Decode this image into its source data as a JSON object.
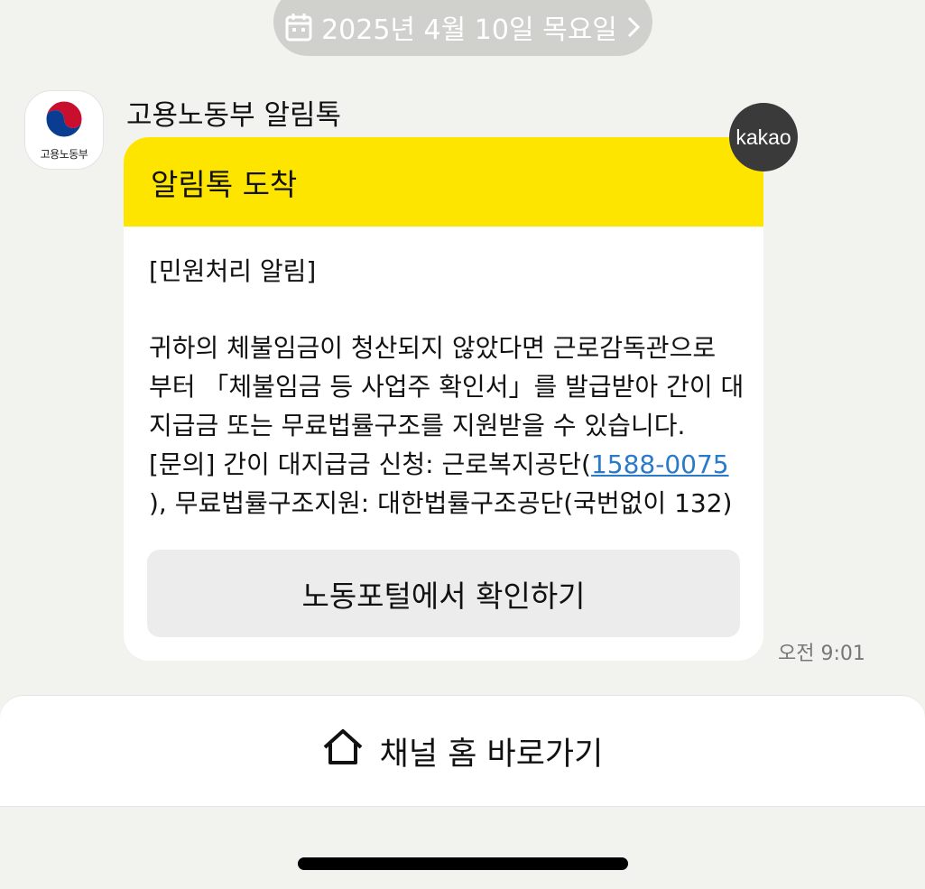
{
  "date_separator": {
    "icon": "calendar-icon",
    "text": "2025년 4월 10일 목요일",
    "chevron": "chevron-right-icon"
  },
  "sender": {
    "avatar_text": "고용노동부",
    "name": "고용노동부 알림톡"
  },
  "message": {
    "header": "알림톡 도착",
    "lines": [
      "[민원처리 알림]",
      "귀하의 체불임금이 청산되지 않았다면 근로감독관으로",
      "부터 「체불임금 등 사업주 확인서」를 발급받아 간이 대",
      "지급금 또는 무료법률구조를 지원받을 수 있습니다."
    ],
    "inquiry_prefix": "[문의] 간이 대지급금 신청: 근로복지공단(",
    "inquiry_phone": "1588-0075",
    "inquiry_suffix": "), 무료법률구조지원: 대한법률구조공단(국번없이 132)",
    "button_label": "노동포털에서 확인하기",
    "timestamp": "오전 9:01",
    "badge": "kakao"
  },
  "channel_home": {
    "icon": "home-icon",
    "label": "채널 홈 바로가기"
  },
  "colors": {
    "background": "#f2f2ef",
    "header_yellow": "#fee500",
    "link_blue": "#2a7ac9",
    "date_pill": "#d0d0cc",
    "kakao_badge": "#3a3a3a"
  }
}
